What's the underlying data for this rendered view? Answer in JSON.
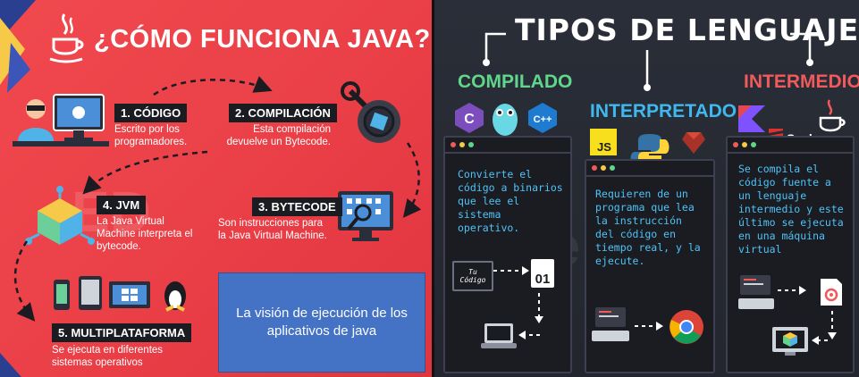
{
  "left": {
    "title": "¿CÓMO FUNCIONA JAVA?",
    "steps": [
      {
        "label": "1. CÓDIGO",
        "desc": "Escrito por los programadores."
      },
      {
        "label": "2. COMPILACIÓN",
        "desc": "Esta compilación devuelve un Bytecode."
      },
      {
        "label": "3. BYTECODE",
        "desc": "Son instrucciones para la Java Virtual Machine."
      },
      {
        "label": "4. JVM",
        "desc": "La Java Virtual Machine interpreta el bytecode."
      },
      {
        "label": "5. MULTIPLATAFORMA",
        "desc": "Se ejecuta en diferentes sistemas operativos"
      }
    ],
    "caption_box": "La visión de ejecución de los aplicativos de java"
  },
  "right": {
    "title": "TIPOS DE LENGUAJE",
    "columns": [
      {
        "heading": "COMPILADO",
        "color": "#5fd68c",
        "text": "Convierte el código a binarios que lee el sistema operativo.",
        "code_label": "Tu Código",
        "binary_label": "01",
        "logos": [
          "C",
          "C++"
        ]
      },
      {
        "heading": "INTERPRETADO",
        "color": "#3fb8f0",
        "text": "Requieren de un programa que lea la instrucción del código en tiempo real, y la ejecute.",
        "logos": [
          "JS"
        ]
      },
      {
        "heading": "INTERMEDIO",
        "color": "#f05a5a",
        "text": "Se compila el código fuente a un lenguaje intermedio y este último se ejecuta en una máquina virtual",
        "logos": [
          "Scala"
        ]
      }
    ]
  },
  "colors": {
    "left_bg": "#ea3f47",
    "right_bg": "#23262e",
    "step_label_bg": "#1b1c22",
    "panel_text": "#4fc3f7",
    "caption_box": "#4472c4"
  }
}
